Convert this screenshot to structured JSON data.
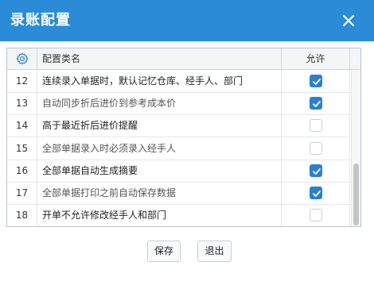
{
  "dialog": {
    "title": "录账配置"
  },
  "grid": {
    "headers": {
      "type": "配置类名",
      "allow": "允许"
    },
    "rows": [
      {
        "num": "12",
        "label": "连续录入单据时，默认记忆仓库、经手人、部门",
        "checked": true
      },
      {
        "num": "13",
        "label": "自动同步折后进价到参考成本价",
        "checked": true
      },
      {
        "num": "14",
        "label": "高于最近折后进价提醒",
        "checked": false
      },
      {
        "num": "15",
        "label": "全部单据录入时必须录入经手人",
        "checked": false
      },
      {
        "num": "16",
        "label": "全部单据自动生成摘要",
        "checked": true
      },
      {
        "num": "17",
        "label": "全部单据打印之前自动保存数据",
        "checked": true
      },
      {
        "num": "18",
        "label": "开单不允许修改经手人和部门",
        "checked": false
      }
    ]
  },
  "buttons": {
    "save": "保存",
    "exit": "退出"
  },
  "colors": {
    "titlebar": "#2b8bd6",
    "checkbox_on": "#2b7fd2"
  }
}
